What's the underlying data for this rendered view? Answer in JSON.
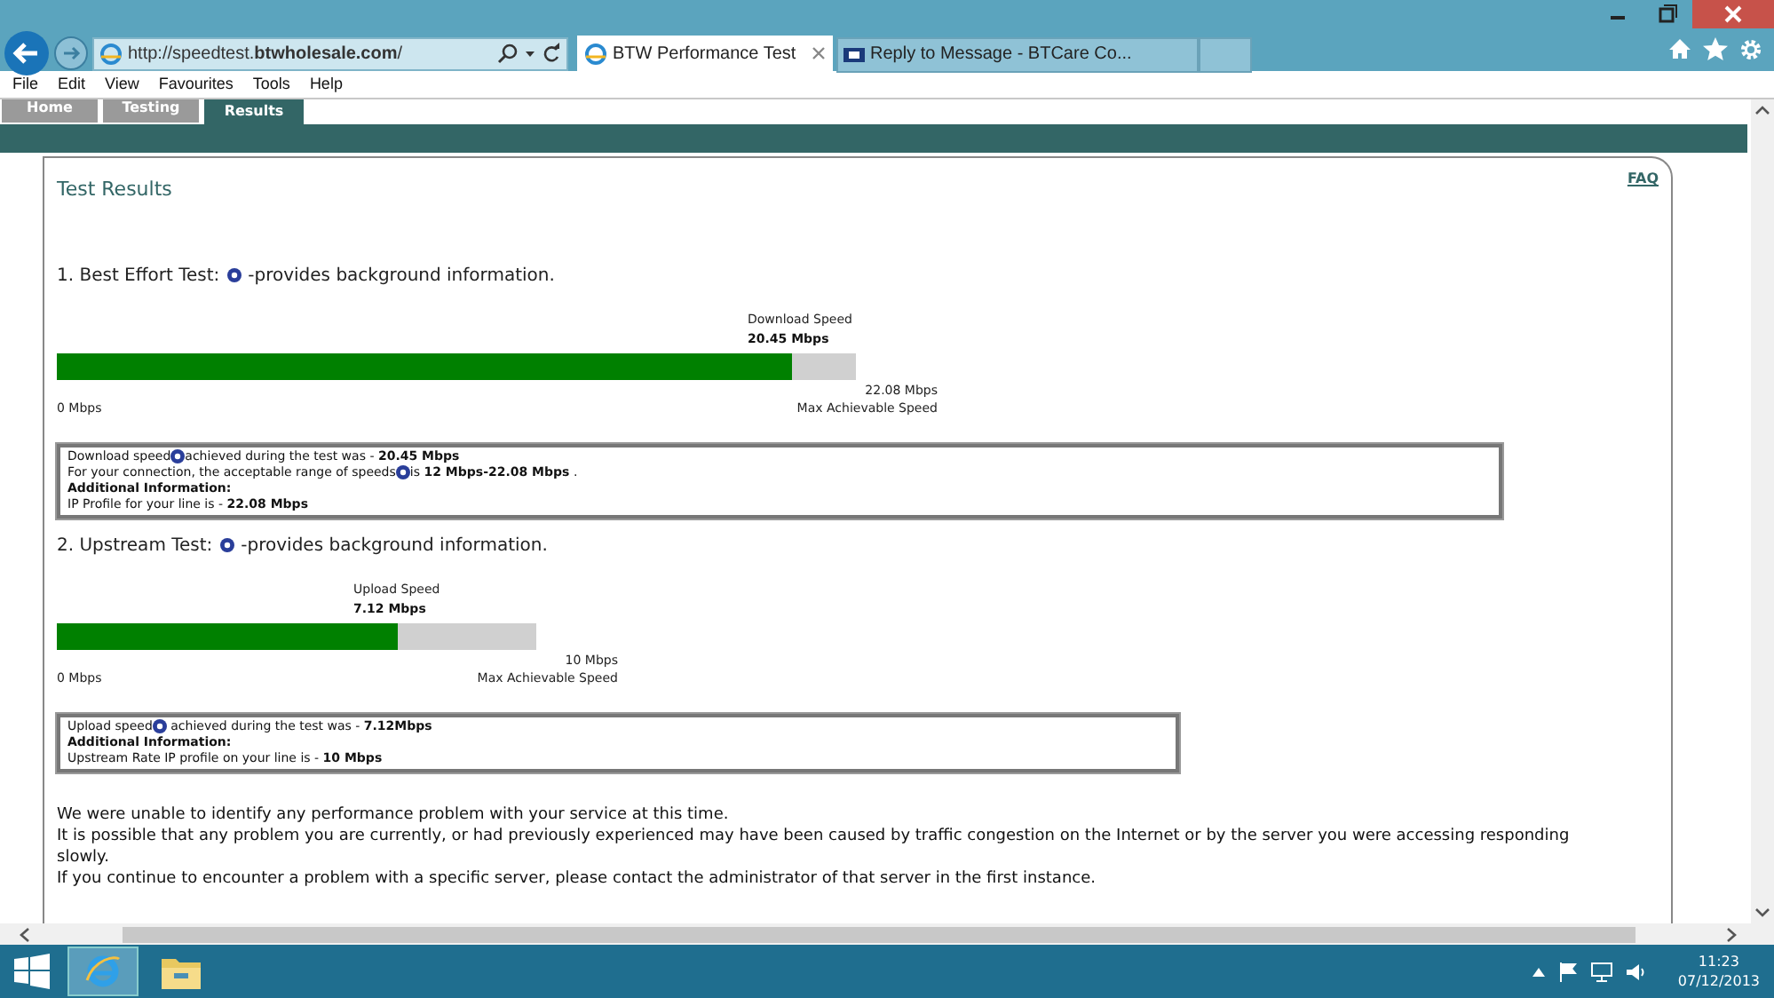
{
  "browser": {
    "address": "http://speedtest.**btwholesale.com**/",
    "tabs": [
      {
        "label": "BTW Performance Test",
        "selected": true,
        "kind": "ie"
      },
      {
        "label": "Reply to Message - BTCare Co...",
        "selected": false,
        "kind": "bt"
      }
    ]
  },
  "menu": [
    "File",
    "Edit",
    "View",
    "Favourites",
    "Tools",
    "Help"
  ],
  "site_tabs": [
    {
      "label": "Home",
      "selected": false
    },
    {
      "label": "Testing",
      "selected": false
    },
    {
      "label": "Results",
      "selected": true
    }
  ],
  "page": {
    "title": "Test Results",
    "faq": "FAQ",
    "tests": [
      {
        "heading": "1. Best Effort Test:",
        "heading_after": "-provides background information.",
        "speed_label": "Download Speed",
        "speed": "20.45 Mbps",
        "level": 0.92,
        "min": "0 Mbps",
        "max": "22.08 Mbps",
        "max_label": "Max Achievable Speed",
        "info": [
          {
            "kind": "help",
            "before": "Download speed",
            "after": "achieved during the test was - **20.45 Mbps**"
          },
          {
            "kind": "help",
            "before": "For your connection, the acceptable range of speeds",
            "after": "is **12 Mbps-22.08 Mbps** ."
          },
          {
            "kind": "label",
            "before": "Additional Information:"
          },
          {
            "kind": "text",
            "before": "IP Profile for your line is - **22.08 Mbps**"
          }
        ]
      },
      {
        "heading": "2. Upstream Test:",
        "heading_after": "-provides background information.",
        "speed_label": "Upload Speed",
        "speed": "7.12 Mbps",
        "level": 0.71,
        "min": "0 Mbps",
        "max": "10 Mbps",
        "max_label": "Max Achievable Speed",
        "info": [
          {
            "kind": "help",
            "before": "Upload speed",
            "after": " achieved during the test was - **7.12Mbps**"
          },
          {
            "kind": "label",
            "before": "Additional Information:"
          },
          {
            "kind": "text",
            "before": "Upstream Rate IP profile on your line is - **10 Mbps**"
          }
        ]
      }
    ],
    "summary": [
      "We were unable to identify any performance problem with your service at this time.",
      "It is possible that any problem you are currently, or had previously experienced may have been caused by traffic congestion on the Internet or by the server you were accessing responding slowly.",
      "If you continue to encounter a problem with a specific server, please contact the administrator of that server in the first instance."
    ]
  },
  "taskbar": {
    "time": "11:23",
    "date": "07/12/2013"
  }
}
